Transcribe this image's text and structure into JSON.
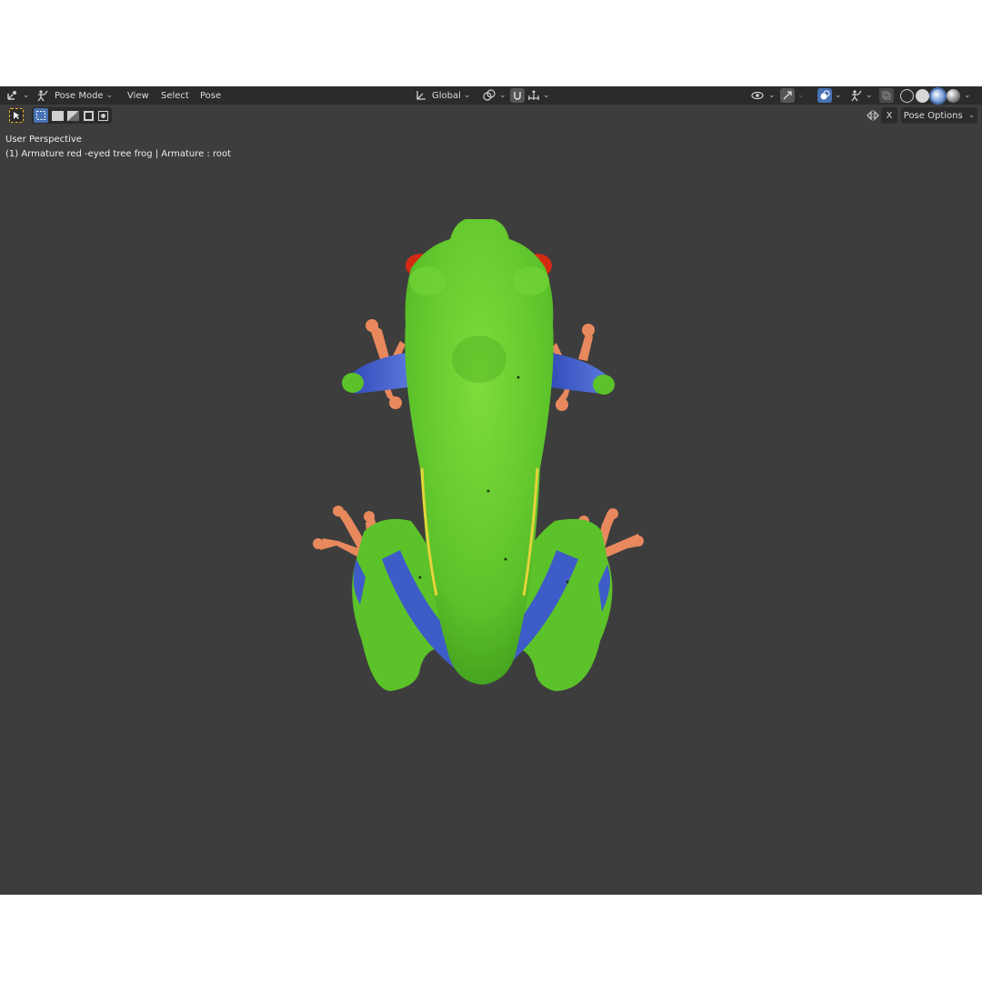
{
  "header": {
    "mode_label": "Pose Mode",
    "menus": [
      "View",
      "Select",
      "Pose"
    ],
    "transform_orientation": "Global"
  },
  "toolbar": {
    "pose_options_label": "Pose Options",
    "x_mirror_label": "X"
  },
  "viewport": {
    "perspective_label": "User Perspective",
    "object_info": "(1) Armature red -eyed tree frog | Armature : root"
  },
  "icons": [
    "editor-type-icon",
    "pose-mode-icon",
    "orientation-icon",
    "pivot-icon",
    "snap-icon",
    "snap-increment-icon",
    "visibility-icon",
    "gizmo-icon",
    "overlay-icon",
    "xray-icon",
    "wireframe-shading-icon",
    "solid-shading-icon",
    "material-shading-icon",
    "rendered-shading-icon",
    "select-tool-icon",
    "select-box-icon",
    "mirror-icon"
  ],
  "colors": {
    "viewport_bg": "#3d3d3d",
    "header_bg": "#2b2b2b",
    "accent": "#4772b3",
    "frog_green": "#5cc22a",
    "frog_blue": "#3e5cc8",
    "frog_orange": "#e8895d",
    "frog_red": "#d42a12"
  }
}
